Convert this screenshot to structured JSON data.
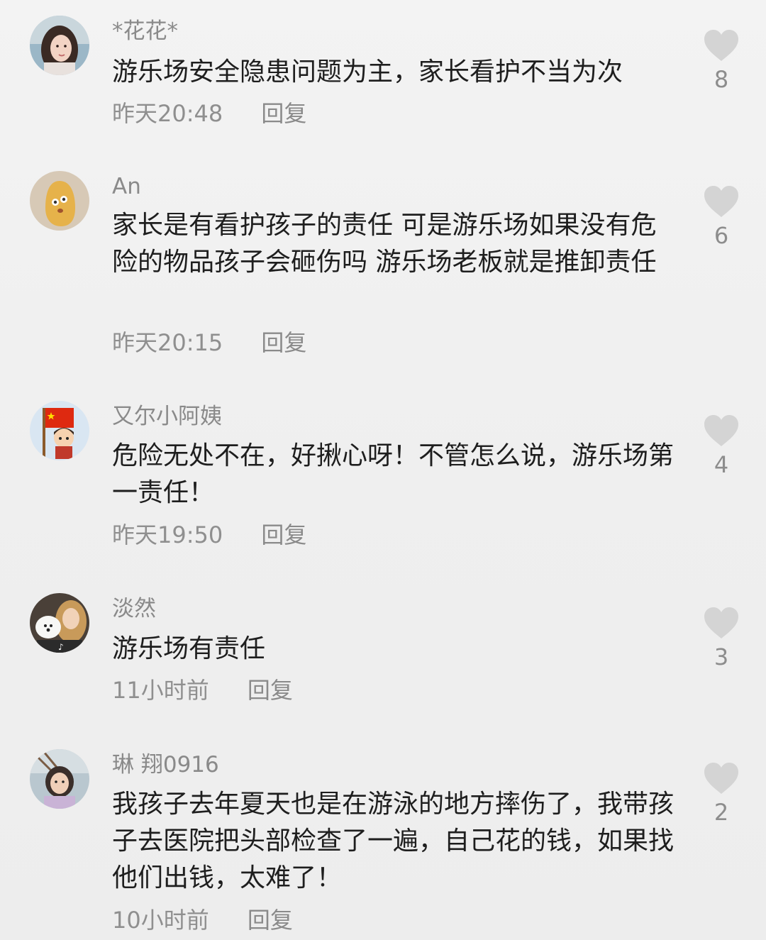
{
  "comments": [
    {
      "username": "*花花*",
      "text": "游乐场安全隐患问题为主，家长看护不当为次",
      "time": "昨天20:48",
      "reply_label": "回复",
      "likes": "8",
      "avatar_icon": "woman-portrait-avatar"
    },
    {
      "username": "An",
      "text": "家长是有看护孩子的责任 可是游乐场如果没有危险的物品孩子会砸伤吗 游乐场老板就是推卸责任",
      "time": "昨天20:15",
      "reply_label": "回复",
      "likes": "6",
      "avatar_icon": "cartoon-bean-avatar"
    },
    {
      "username": "又尔小阿姨",
      "text": "危险无处不在，好揪心呀！不管怎么说，游乐场第一责任！",
      "time": "昨天19:50",
      "reply_label": "回复",
      "likes": "4",
      "avatar_icon": "flag-cartoon-avatar"
    },
    {
      "username": "淡然",
      "text": "游乐场有责任",
      "time": "11小时前",
      "reply_label": "回复",
      "likes": "3",
      "avatar_icon": "woman-with-dog-avatar"
    },
    {
      "username": "琳 翔0916",
      "text": "我孩子去年夏天也是在游泳的地方摔伤了，我带孩子去医院把头部检查了一遍，自己花的钱，如果找他们出钱，太难了！",
      "time": "10小时前",
      "reply_label": "回复",
      "likes": "2",
      "avatar_icon": "woman-outdoor-avatar"
    }
  ],
  "colors": {
    "background": "#f0f0f0",
    "text": "#1e1e1e",
    "meta": "#8f8f8f",
    "heart": "#d4d4d4"
  }
}
